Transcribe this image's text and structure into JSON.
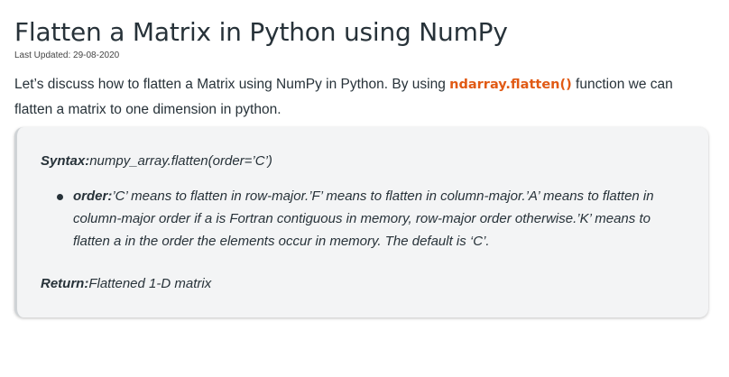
{
  "article": {
    "title": "Flatten a Matrix in Python using NumPy",
    "last_updated": "Last Updated: 29-08-2020",
    "intro_before": "Let’s discuss how to flatten a Matrix using NumPy in Python. By using ",
    "intro_code": "ndarray.flatten()",
    "intro_after": " function we can flatten a matrix to one dimension in python."
  },
  "infobox": {
    "syntax_label": "Syntax:",
    "syntax_value": "numpy_array.flatten(order=’C’)",
    "param_label": "order:",
    "param_text": "’C’ means to flatten in row-major.’F’ means to flatten in column-major.’A’ means to flatten in column-major order if a is Fortran contiguous in memory, row-major order otherwise.’K’ means to flatten a in the order the elements occur in memory. The default is ‘C’.",
    "return_label": "Return:",
    "return_value": "Flattened 1-D matrix"
  }
}
